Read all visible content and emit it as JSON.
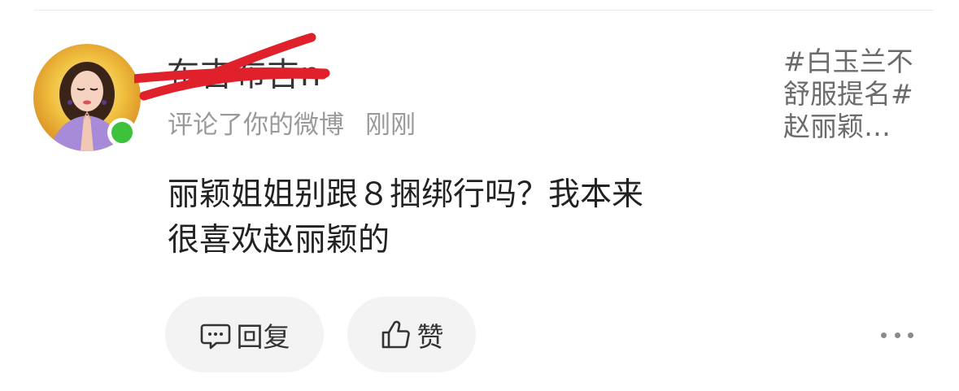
{
  "comment_item": {
    "username": "布吉布吉n",
    "meta_action": "评论了你的微博",
    "meta_time": "刚刚",
    "comment_lines": [
      "丽颖姐姐别跟８捆绑行吗？我本来",
      "很喜欢赵丽颖的"
    ],
    "weibo_preview_lines": [
      "#白玉兰不",
      "舒服提名#",
      "赵丽颖…"
    ],
    "actions": {
      "reply_label": "回复",
      "like_label": "赞"
    },
    "status": {
      "online": true,
      "online_color": "#3ec13b"
    },
    "redaction_color": "#e0202a"
  }
}
